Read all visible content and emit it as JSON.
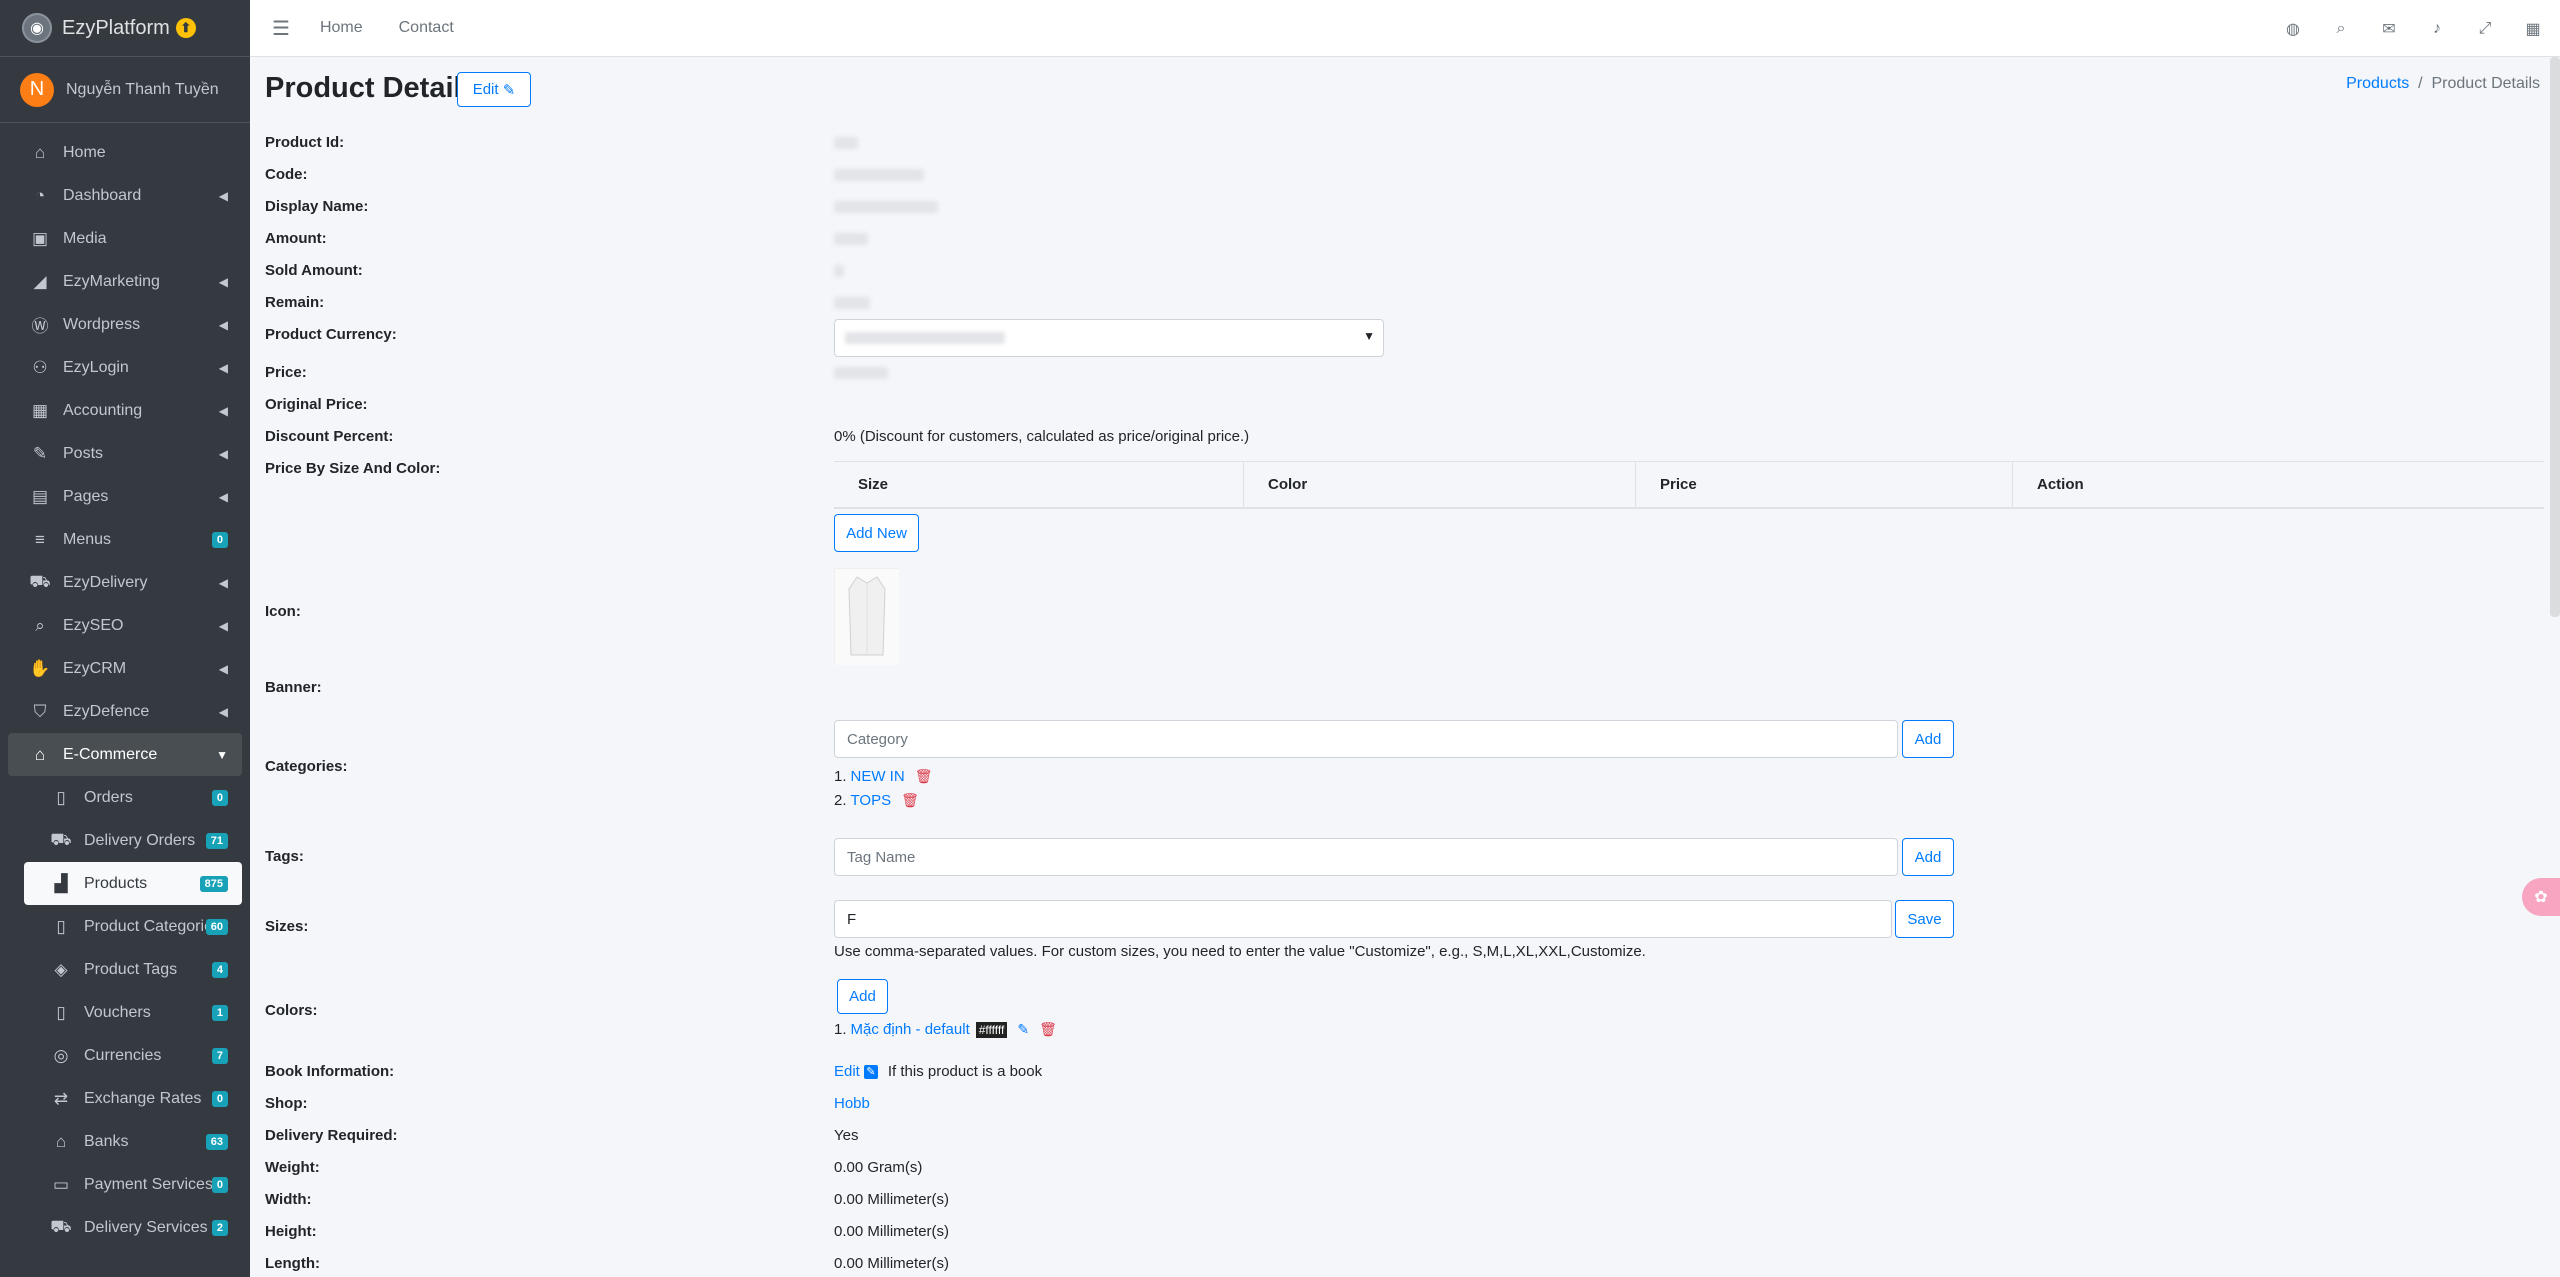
{
  "brand": {
    "name": "EzyPlatform",
    "badge": "⬆"
  },
  "user": {
    "initial": "N",
    "name": "Nguyễn Thanh Tuyền"
  },
  "sidebar": {
    "items": [
      {
        "label": "Home",
        "icon": "home-icon"
      },
      {
        "label": "Dashboard",
        "icon": "dashboard-icon"
      },
      {
        "label": "Media",
        "icon": "media-icon"
      },
      {
        "label": "EzyMarketing",
        "icon": "megaphone-icon"
      },
      {
        "label": "Wordpress",
        "icon": "wordpress-icon"
      },
      {
        "label": "EzyLogin",
        "icon": "login-icon"
      },
      {
        "label": "Accounting",
        "icon": "calculator-icon"
      },
      {
        "label": "Posts",
        "icon": "posts-icon"
      },
      {
        "label": "Pages",
        "icon": "pages-icon"
      },
      {
        "label": "Menus",
        "icon": "menu-icon",
        "badge": "0"
      },
      {
        "label": "EzyDelivery",
        "icon": "truck-icon"
      },
      {
        "label": "EzySEO",
        "icon": "seo-icon"
      },
      {
        "label": "EzyCRM",
        "icon": "handshake-icon"
      },
      {
        "label": "EzyDefence",
        "icon": "shield-icon"
      },
      {
        "label": "E-Commerce",
        "icon": "basket-icon"
      }
    ],
    "sub_items": [
      {
        "label": "Orders",
        "badge": "0"
      },
      {
        "label": "Delivery Orders",
        "badge": "71"
      },
      {
        "label": "Products",
        "badge": "875"
      },
      {
        "label": "Product Categories",
        "badge": "60"
      },
      {
        "label": "Product Tags",
        "badge": "4"
      },
      {
        "label": "Vouchers",
        "badge": "1"
      },
      {
        "label": "Currencies",
        "badge": "7"
      },
      {
        "label": "Exchange Rates",
        "badge": "0"
      },
      {
        "label": "Banks",
        "badge": "63"
      },
      {
        "label": "Payment Services",
        "badge": "0"
      },
      {
        "label": "Delivery Services",
        "badge": "2"
      }
    ]
  },
  "topnav": {
    "home": "Home",
    "contact": "Contact"
  },
  "page": {
    "title": "Product Details",
    "edit_label": "Edit",
    "breadcrumb": {
      "parent": "Products",
      "sep": "/",
      "current": "Product Details"
    }
  },
  "labels": {
    "product_id": "Product Id:",
    "code": "Code:",
    "display_name": "Display Name:",
    "amount": "Amount:",
    "sold_amount": "Sold Amount:",
    "remain": "Remain:",
    "currency": "Product Currency:",
    "price": "Price:",
    "original_price": "Original Price:",
    "discount_percent": "Discount Percent:",
    "price_by": "Price By Size And Color:",
    "icon": "Icon:",
    "banner": "Banner:",
    "categories": "Categories:",
    "tags": "Tags:",
    "sizes": "Sizes:",
    "colors": "Colors:",
    "book_info": "Book Information:",
    "shop": "Shop:",
    "delivery_required": "Delivery Required:",
    "weight": "Weight:",
    "width": "Width:",
    "height": "Height:",
    "length": "Length:"
  },
  "values": {
    "discount": "0% (Discount for customers, calculated as price/original price.)",
    "price_table_headers": [
      "Size",
      "Color",
      "Price",
      "Action"
    ],
    "add_new": "Add New",
    "category_placeholder": "Category",
    "add": "Add",
    "categories": [
      {
        "num": "1.",
        "name": "NEW IN"
      },
      {
        "num": "2.",
        "name": "TOPS"
      }
    ],
    "tag_placeholder": "Tag Name",
    "sizes_value": "F",
    "save": "Save",
    "sizes_help": "Use comma-separated values. For custom sizes, you need to enter the value \"Customize\", e.g., S,M,L,XL,XXL,Customize.",
    "color_add": "Add",
    "color_num": "1.",
    "color_name": "Mặc định - default",
    "color_hex": "#ffffff",
    "book_edit": "Edit",
    "book_note": "If this product is a book",
    "shop": "Hobb",
    "delivery_required": "Yes",
    "weight": "0.00 Gram(s)",
    "width": "0.00 Millimeter(s)",
    "height": "0.00 Millimeter(s)",
    "length": "0.00 Millimeter(s)"
  }
}
